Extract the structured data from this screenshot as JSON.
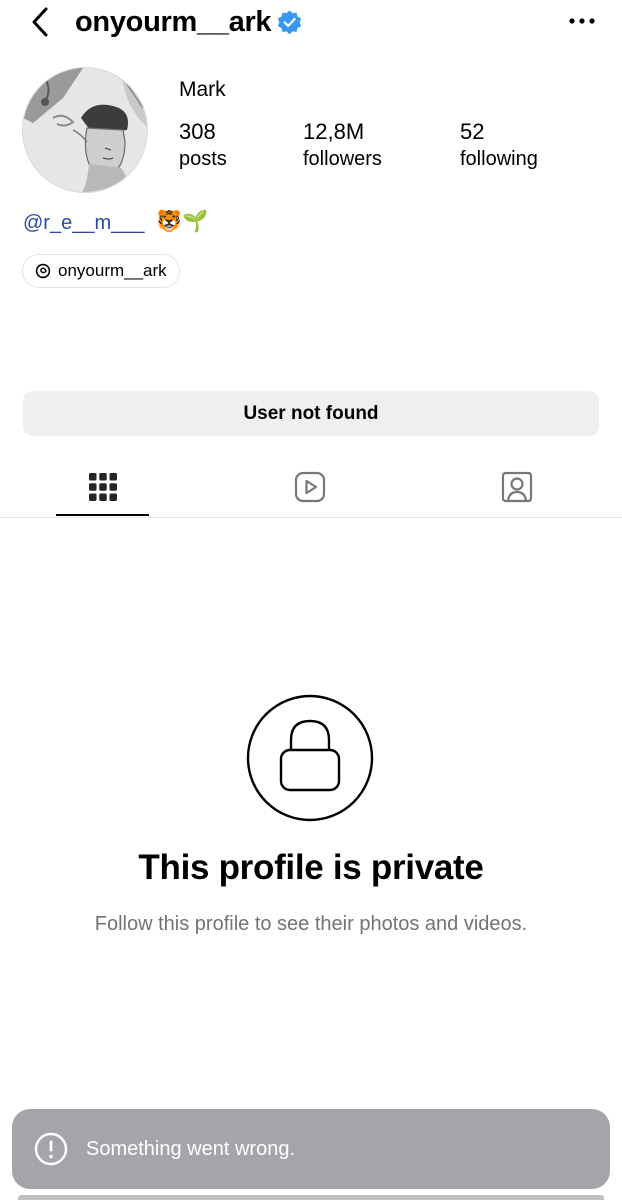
{
  "header": {
    "username": "onyourm__ark",
    "back_icon": "chevron-left-icon",
    "verified_icon": "verified-badge-icon",
    "more_icon": "more-horizontal-icon"
  },
  "profile": {
    "display_name": "Mark",
    "stats": [
      {
        "value": "308",
        "label": "posts"
      },
      {
        "value": "12,8M",
        "label": "followers"
      },
      {
        "value": "52",
        "label": "following"
      }
    ],
    "bio_mention": "@r_e__m___",
    "bio_emoji": "🐯🌱",
    "threads_handle": "onyourm__ark",
    "threads_icon": "threads-icon"
  },
  "status_button": "User not found",
  "tabs": [
    {
      "name": "grid",
      "icon": "grid-icon",
      "active": true
    },
    {
      "name": "reels",
      "icon": "reels-icon",
      "active": false
    },
    {
      "name": "tagged",
      "icon": "tagged-icon",
      "active": false
    }
  ],
  "private_notice": {
    "icon": "lock-icon",
    "title": "This profile is private",
    "subtitle": "Follow this profile to see their photos and videos."
  },
  "toast": {
    "icon": "alert-circle-icon",
    "message": "Something went wrong."
  },
  "colors": {
    "verified_blue": "#3897f0",
    "mention_blue": "#2c4a9c",
    "secondary_text": "#737373",
    "button_bg": "#efefef",
    "toast_bg": "#a3a5a8"
  }
}
